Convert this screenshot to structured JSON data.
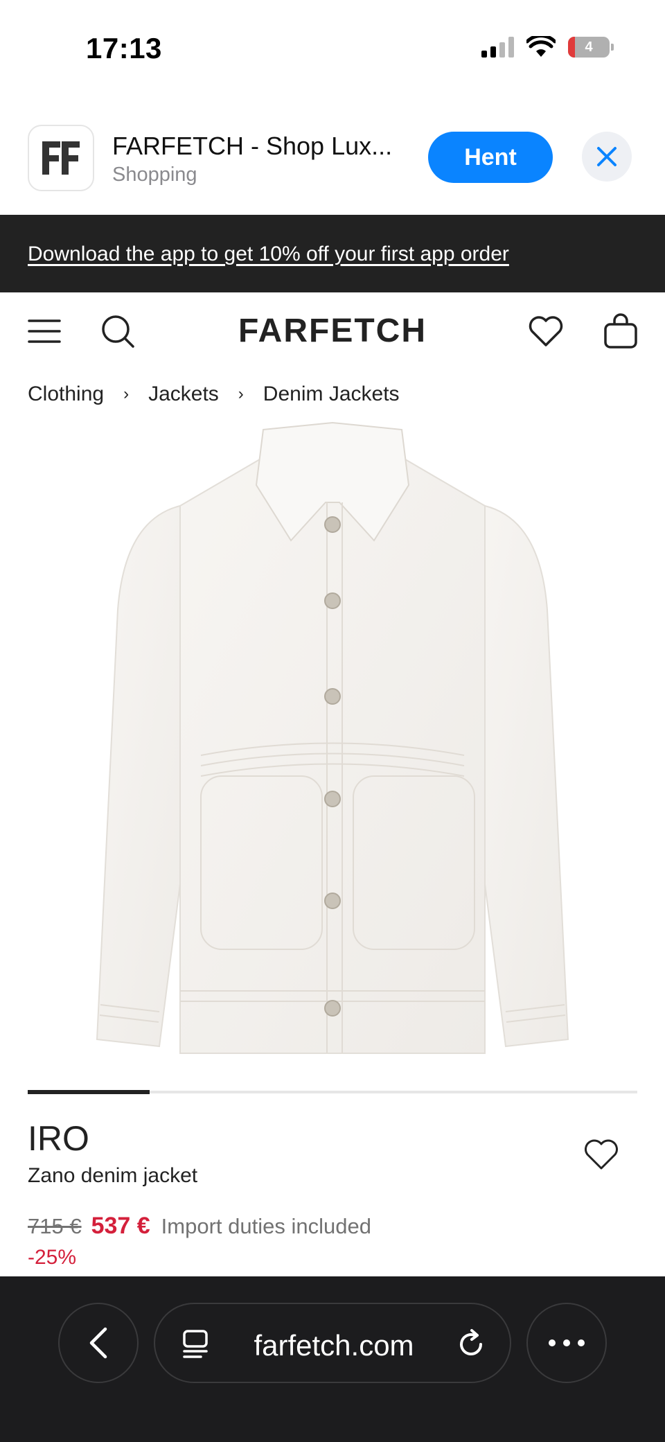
{
  "status_bar": {
    "time": "17:13",
    "battery": "4"
  },
  "app_banner": {
    "title": "FARFETCH - Shop Lux...",
    "subtitle": "Shopping",
    "get_label": "Hent",
    "accent_color": "#0a84ff"
  },
  "promo": {
    "text": "Download the app to get 10% off your first app order"
  },
  "nav": {
    "logo": "FARFETCH",
    "icons": [
      "menu-icon",
      "search-icon",
      "heart-icon",
      "bag-icon"
    ]
  },
  "breadcrumb": {
    "items": [
      "Clothing",
      "Jackets",
      "Denim Jackets"
    ],
    "separator": "›"
  },
  "carousel": {
    "current_index": 0
  },
  "product": {
    "brand": "IRO",
    "name": "Zano denim jacket",
    "old_price": "715 €",
    "price": "537 €",
    "duties_note": "Import duties included",
    "discount": "-25%",
    "sale_color": "#d4203b"
  },
  "browser": {
    "url": "farfetch.com"
  }
}
